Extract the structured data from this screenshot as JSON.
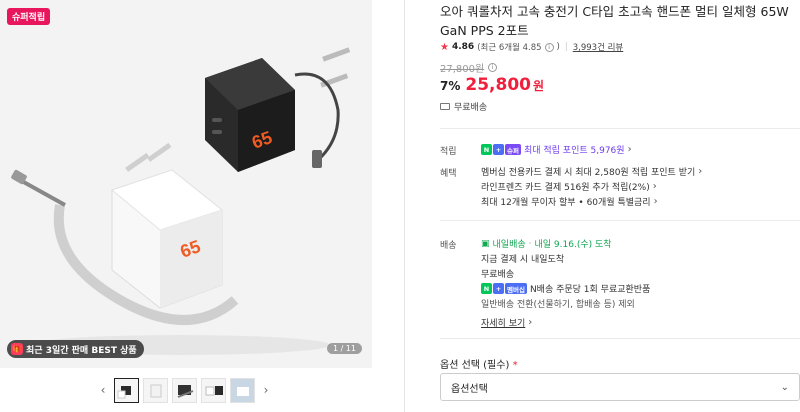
{
  "gallery": {
    "badge_top": "슈퍼적립",
    "badge_best": "최근 3일간 판매 BEST 상품",
    "counter": "1 / 11",
    "prev_icon": "chevron-left-icon",
    "next_icon": "chevron-right-icon",
    "thumb_count": 5
  },
  "product": {
    "title": "오아 쿼롤차저 고속 충전기 C타입 초고속 핸드폰 멀티 일체형 65W GaN PPS 2포트",
    "rating": "4.86",
    "rating_detail": "(최근 6개월 4.85",
    "rating_detail_close": ")",
    "reviews": "3,993건 리뷰",
    "original_price": "27,800원",
    "discount_rate": "7%",
    "price": "25,800",
    "price_unit": "원",
    "shipping_free": "무료배송"
  },
  "benefits": {
    "points_label": "적립",
    "points_text": "최대 적립 포인트 5,976원",
    "npay_tag": "슈퍼",
    "benefit_label": "혜택",
    "benefit_lines": [
      "멤버십 전용카드 결제 시 최대 2,580원 적립 포인트 받기",
      "라인프렌즈 카드 결제 516원 추가 적립(2%)",
      "최대 12개월 무이자 할부 • 60개월 특별금리"
    ]
  },
  "delivery": {
    "label": "배송",
    "tag": "내일배송",
    "eta": "내일 9.16.(수) 도착",
    "line1": "지금 결제 시 내일도착",
    "line2": "무료배송",
    "npay_tag": "멤버십",
    "line3": "N배송 주문당 1회 무료교환반품",
    "line4": "일반배송 전환(선물하기, 합배송 등) 제외",
    "more": "자세히 보기"
  },
  "options": {
    "label": "옵션 선택 (필수)",
    "required_mark": "*",
    "select_value": "옵션선택"
  },
  "colors": {
    "accent_red": "#f0203c",
    "npay_green": "#03c75a",
    "points_purple": "#6d3cf0",
    "delivery_green": "#12a552"
  }
}
